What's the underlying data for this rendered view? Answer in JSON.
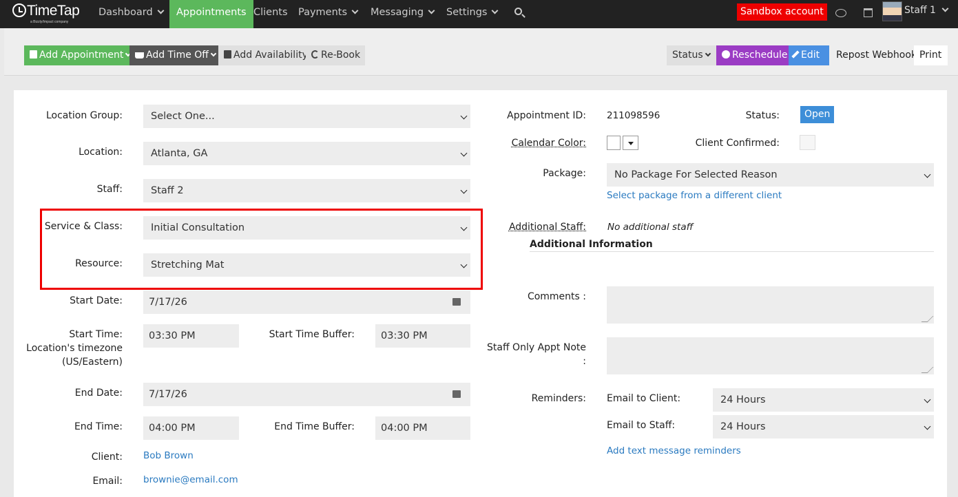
{
  "nav": {
    "logo": "TimeTap",
    "logo_sub": "a Bizzly/Impact company",
    "items": [
      "Dashboard",
      "Appointments",
      "Clients",
      "Payments",
      "Messaging",
      "Settings"
    ],
    "sandbox": "Sandbox account",
    "user": "Staff 1"
  },
  "toolbar": {
    "add_appointment": "Add Appointment",
    "add_time_off": "Add Time Off",
    "add_availability": "Add Availability",
    "rebook": "Re-Book",
    "status": "Status",
    "reschedule": "Reschedule",
    "edit": "Edit",
    "repost_webhook": "Repost Webhook",
    "print": "Print"
  },
  "form": {
    "location_group": {
      "label": "Location Group:",
      "value": "Select One..."
    },
    "location": {
      "label": "Location:",
      "value": "Atlanta, GA"
    },
    "staff": {
      "label": "Staff:",
      "value": "Staff 2"
    },
    "service": {
      "label": "Service & Class:",
      "value": "Initial Consultation"
    },
    "resource": {
      "label": "Resource:",
      "value": "Stretching Mat"
    },
    "start_date": {
      "label": "Start Date:",
      "value": "7/17/26"
    },
    "start_time": {
      "label_1": "Start Time:",
      "label_2": "Location's timezone",
      "label_3": "(US/Eastern)",
      "value": "03:30 PM"
    },
    "start_buffer": {
      "label": "Start Time Buffer:",
      "value": "03:30 PM"
    },
    "end_date": {
      "label": "End Date:",
      "value": "7/17/26"
    },
    "end_time": {
      "label": "End Time:",
      "value": "04:00 PM"
    },
    "end_buffer": {
      "label": "End Time Buffer:",
      "value": "04:00 PM"
    },
    "client": {
      "label": "Client:",
      "value": "Bob Brown"
    },
    "email": {
      "label": "Email:",
      "value": "brownie@email.com"
    }
  },
  "details": {
    "appt_id": {
      "label": "Appointment ID:",
      "value": "211098596"
    },
    "status": {
      "label": "Status:",
      "value": "Open"
    },
    "calendar_color": {
      "label": "Calendar Color:"
    },
    "client_confirmed": {
      "label": "Client Confirmed:"
    },
    "package": {
      "label": "Package:",
      "value": "No Package For Selected Reason",
      "link": "Select package from a different client"
    },
    "additional_staff": {
      "label": "Additional Staff:",
      "value": "No additional staff"
    },
    "additional_info": "Additional Information",
    "comments": {
      "label": "Comments :"
    },
    "staff_note": {
      "label_1": "Staff Only Appt Note",
      "label_2": ":"
    },
    "reminders": {
      "label": "Reminders:",
      "email_client": {
        "label": "Email to Client:",
        "value": "24 Hours"
      },
      "email_staff": {
        "label": "Email to Staff:",
        "value": "24 Hours"
      },
      "link": "Add text message reminders"
    }
  },
  "colors": {
    "accent_green": "#5cb85c",
    "reschedule": "#9b3cc4",
    "edit": "#4a90e2",
    "sandbox": "#ee0000",
    "highlight": "#ee0000"
  }
}
